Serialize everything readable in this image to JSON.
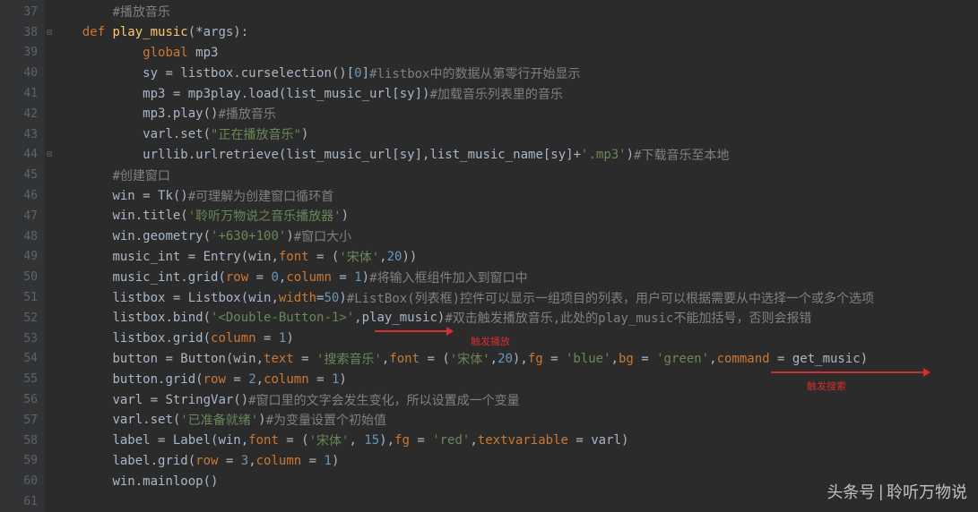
{
  "line_numbers": [
    "37",
    "38",
    "39",
    "40",
    "41",
    "42",
    "43",
    "44",
    "45",
    "46",
    "47",
    "48",
    "49",
    "50",
    "51",
    "52",
    "53",
    "54",
    "55",
    "56",
    "57",
    "58",
    "59",
    "60",
    "61"
  ],
  "lines": {
    "l37": {
      "indent": "        ",
      "c1": "#播放音乐"
    },
    "l38": {
      "indent": "    ",
      "kw1": "def ",
      "fn": "play_music",
      "p1": "(*args):"
    },
    "l39": {
      "indent": "            ",
      "kw1": "global ",
      "id1": "mp3"
    },
    "l40": {
      "indent": "            ",
      "id1": "sy = listbox.curselection()[",
      "n1": "0",
      "id2": "]",
      "c1": "#listbox中的数据从第零行开始显示"
    },
    "l41": {
      "indent": "            ",
      "id1": "mp3 = mp3play.load(list_music_url[sy])",
      "c1": "#加载音乐列表里的音乐"
    },
    "l42": {
      "indent": "            ",
      "id1": "mp3.play()",
      "c1": "#播放音乐"
    },
    "l43": {
      "indent": "            ",
      "id1": "varl.set(",
      "s1": "\"正在播放音乐\"",
      "id2": ")"
    },
    "l44": {
      "indent": "            ",
      "id1": "urllib.urlretrieve(list_music_url[sy],list_music_name[sy]+",
      "s1": "'.mp3'",
      "id2": ")",
      "c1": "#下载音乐至本地"
    },
    "l45": {
      "indent": "        ",
      "c1": "#创建窗口"
    },
    "l46": {
      "indent": "        ",
      "id1": "win = Tk()",
      "c1": "#可理解为创建窗口循环首"
    },
    "l47": {
      "indent": "        ",
      "id1": "win.title(",
      "s1": "'聆听万物说之音乐播放器'",
      "id2": ")"
    },
    "l48": {
      "indent": "        ",
      "id1": "win.geometry(",
      "s1": "'+630+100'",
      "id2": ")",
      "c1": "#窗口大小"
    },
    "l49": {
      "indent": "        ",
      "id1": "music_int = Entry(win,",
      "kw1": "font",
      "id2": " = (",
      "s1": "'宋体'",
      "id3": ",",
      "n1": "20",
      "id4": "))"
    },
    "l50": {
      "indent": "        ",
      "id1": "music_int.grid(",
      "kw1": "row",
      "id2": " = ",
      "n1": "0",
      "id3": ",",
      "kw2": "column",
      "id4": " = ",
      "n2": "1",
      "id5": ")",
      "c1": "#将输入框组件加入到窗口中"
    },
    "l51": {
      "indent": "        ",
      "id1": "listbox = Listbox(win,",
      "kw1": "width",
      "id2": "=",
      "n1": "50",
      "id3": ")",
      "c1": "#ListBox(列表框)控件可以显示一组项目的列表，用户可以根据需要从中选择一个或多个选项"
    },
    "l52": {
      "indent": "        ",
      "id1": "listbox.bind(",
      "s1": "'<Double-Button-1>'",
      "id2": ",play_music)",
      "c1": "#双击触发播放音乐,此处的play_music不能加括号，否则会报错"
    },
    "l53": {
      "indent": "        ",
      "id1": "listbox.grid(",
      "kw1": "column",
      "id2": " = ",
      "n1": "1",
      "id3": ")"
    },
    "l54": {
      "indent": "        ",
      "id1": "button = Button(win,",
      "kw1": "text",
      "id2": " = ",
      "s1": "'搜索音乐'",
      "id3": ",",
      "kw2": "font",
      "id4": " = (",
      "s2": "'宋体'",
      "id5": ",",
      "n1": "20",
      "id6": "),",
      "kw3": "fg",
      "id7": " = ",
      "s3": "'blue'",
      "id8": ",",
      "kw4": "bg",
      "id9": " = ",
      "s4": "'green'",
      "id10": ",",
      "kw5": "command",
      "id11": " = get_music)"
    },
    "l55": {
      "indent": "        ",
      "id1": "button.grid(",
      "kw1": "row",
      "id2": " = ",
      "n1": "2",
      "id3": ",",
      "kw2": "column",
      "id4": " = ",
      "n2": "1",
      "id5": ")"
    },
    "l56": {
      "indent": "        ",
      "id1": "varl = StringVar()",
      "c1": "#窗口里的文字会发生变化，所以设置成一个变量"
    },
    "l57": {
      "indent": "        ",
      "id1": "varl.set(",
      "s1": "'已准备就绪'",
      "id2": ")",
      "c1": "#为变量设置个初始值"
    },
    "l58": {
      "indent": "        ",
      "id1": "label = Label(win,",
      "kw1": "font",
      "id2": " = (",
      "s1": "'宋体'",
      "id3": ", ",
      "n1": "15",
      "id4": "),",
      "kw2": "fg",
      "id5": " = ",
      "s2": "'red'",
      "id6": ",",
      "kw3": "textvariable",
      "id7": " = varl)"
    },
    "l59": {
      "indent": "        ",
      "id1": "label.grid(",
      "kw1": "row",
      "id2": " = ",
      "n1": "3",
      "id3": ",",
      "kw2": "column",
      "id4": " = ",
      "n2": "1",
      "id5": ")"
    },
    "l60": {
      "indent": "        ",
      "id1": "win.mainloop()"
    }
  },
  "annotations": {
    "a1": "触发播放",
    "a2": "触发搜索"
  },
  "watermark": {
    "label": "头条号",
    "divider": "|",
    "name": "聆听万物说"
  },
  "fold": {
    "collapse": "⊟",
    "expand": "⊟"
  }
}
